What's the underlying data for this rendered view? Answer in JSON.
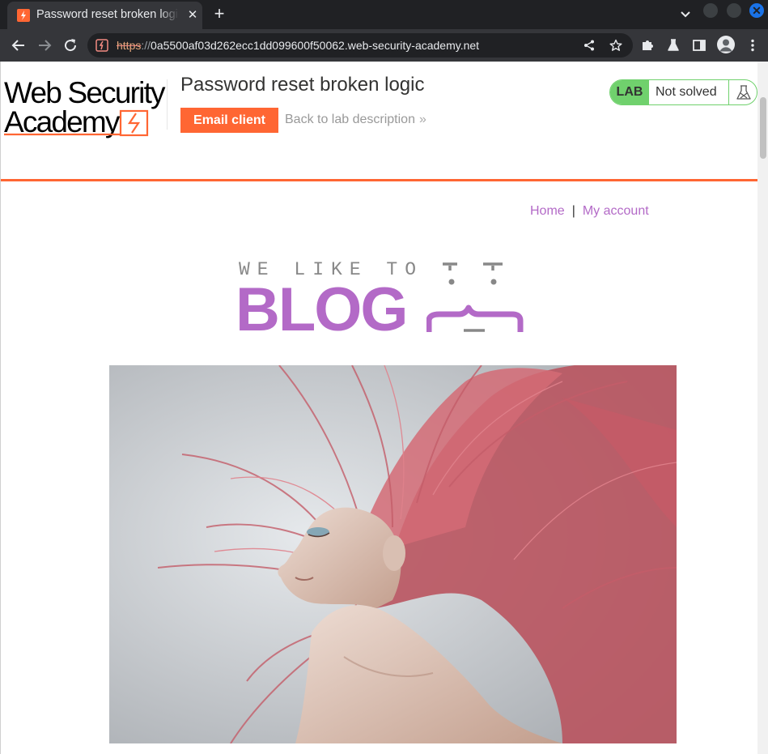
{
  "browser": {
    "tab_title": "Password reset broken logic",
    "new_tab_symbol": "+",
    "close_symbol": "✕",
    "url_scheme": "https",
    "url_sep": "://",
    "url_host": "0a5500af03d262ecc1dd099600f50062.web-security-academy.net"
  },
  "header": {
    "logo_line1": "Web Security",
    "logo_line2": "Academy",
    "lab_title": "Password reset broken logic",
    "email_client_label": "Email client",
    "back_link_label": "Back to lab description",
    "back_chevron": "»",
    "lab_tag": "LAB",
    "lab_status": "Not solved"
  },
  "nav": {
    "home": "Home",
    "separator": "|",
    "my_account": "My account"
  },
  "banner": {
    "subtitle": "WE LIKE TO",
    "title": "BLOG"
  },
  "colors": {
    "accent": "#ff6633",
    "link": "#b36ac7",
    "lab_green": "#70d16d"
  }
}
